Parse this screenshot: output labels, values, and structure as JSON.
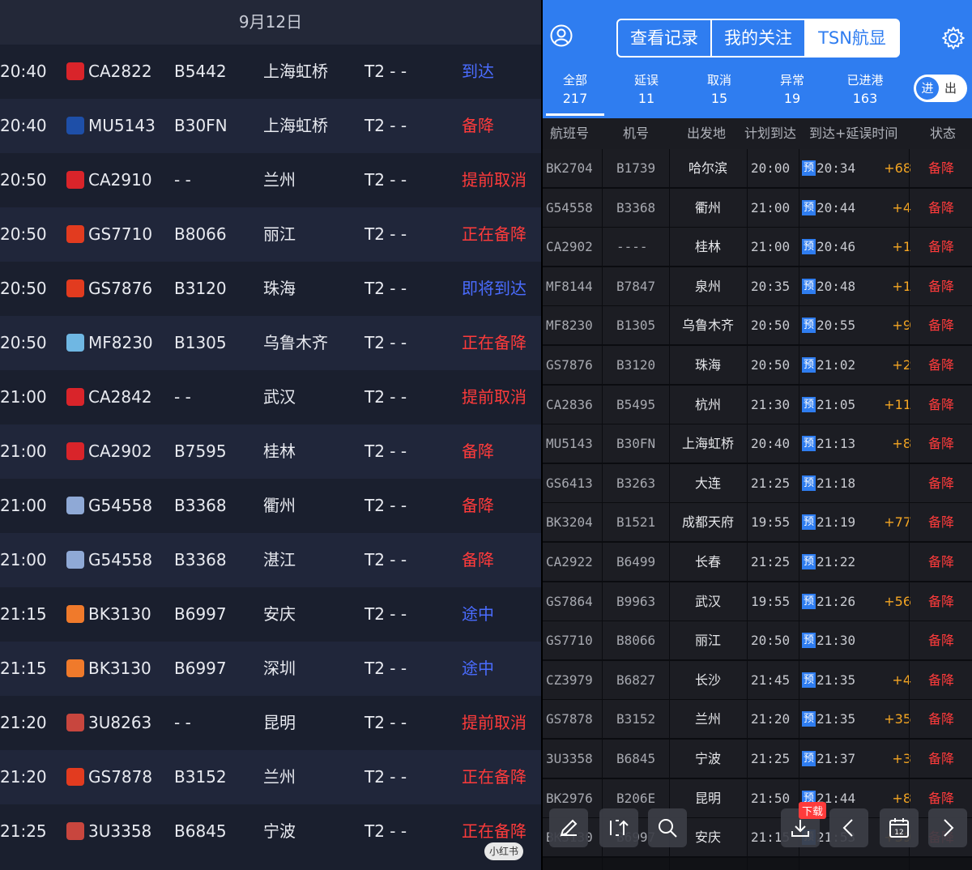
{
  "left_panel": {
    "date": "9月12日",
    "rows": [
      {
        "time": "20:40",
        "logo": "CA",
        "flight": "CA2822",
        "tail": "B5442",
        "city": "上海虹桥",
        "terminal": "T2 - -",
        "status": "到达",
        "status_color": "blue"
      },
      {
        "time": "20:40",
        "logo": "MU",
        "flight": "MU5143",
        "tail": "B30FN",
        "city": "上海虹桥",
        "terminal": "T2 - -",
        "status": "备降",
        "status_color": "red"
      },
      {
        "time": "20:50",
        "logo": "CA",
        "flight": "CA2910",
        "tail": "- -",
        "city": "兰州",
        "terminal": "T2 - -",
        "status": "提前取消",
        "status_color": "red"
      },
      {
        "time": "20:50",
        "logo": "GS",
        "flight": "GS7710",
        "tail": "B8066",
        "city": "丽江",
        "terminal": "T2 - -",
        "status": "正在备降",
        "status_color": "red"
      },
      {
        "time": "20:50",
        "logo": "GS",
        "flight": "GS7876",
        "tail": "B3120",
        "city": "珠海",
        "terminal": "T2 - -",
        "status": "即将到达",
        "status_color": "blue"
      },
      {
        "time": "20:50",
        "logo": "MF",
        "flight": "MF8230",
        "tail": "B1305",
        "city": "乌鲁木齐",
        "terminal": "T2 - -",
        "status": "正在备降",
        "status_color": "red"
      },
      {
        "time": "21:00",
        "logo": "CA",
        "flight": "CA2842",
        "tail": "- -",
        "city": "武汉",
        "terminal": "T2 - -",
        "status": "提前取消",
        "status_color": "red"
      },
      {
        "time": "21:00",
        "logo": "CA",
        "flight": "CA2902",
        "tail": "B7595",
        "city": "桂林",
        "terminal": "T2 - -",
        "status": "备降",
        "status_color": "red"
      },
      {
        "time": "21:00",
        "logo": "G5",
        "flight": "G54558",
        "tail": "B3368",
        "city": "衢州",
        "terminal": "T2 - -",
        "status": "备降",
        "status_color": "red"
      },
      {
        "time": "21:00",
        "logo": "G5",
        "flight": "G54558",
        "tail": "B3368",
        "city": "湛江",
        "terminal": "T2 - -",
        "status": "备降",
        "status_color": "red"
      },
      {
        "time": "21:15",
        "logo": "BK",
        "flight": "BK3130",
        "tail": "B6997",
        "city": "安庆",
        "terminal": "T2 - -",
        "status": "途中",
        "status_color": "blue"
      },
      {
        "time": "21:15",
        "logo": "BK",
        "flight": "BK3130",
        "tail": "B6997",
        "city": "深圳",
        "terminal": "T2 - -",
        "status": "途中",
        "status_color": "blue"
      },
      {
        "time": "21:20",
        "logo": "3U",
        "flight": "3U8263",
        "tail": "- -",
        "city": "昆明",
        "terminal": "T2 - -",
        "status": "提前取消",
        "status_color": "red"
      },
      {
        "time": "21:20",
        "logo": "GS",
        "flight": "GS7878",
        "tail": "B3152",
        "city": "兰州",
        "terminal": "T2 - -",
        "status": "正在备降",
        "status_color": "red"
      },
      {
        "time": "21:25",
        "logo": "3U",
        "flight": "3U3358",
        "tail": "B6845",
        "city": "宁波",
        "terminal": "T2 - -",
        "status": "正在备降",
        "status_color": "red"
      }
    ],
    "watermark": "小红书"
  },
  "right_panel": {
    "segments": [
      "查看记录",
      "我的关注",
      "TSN航显"
    ],
    "active_segment": "TSN航显",
    "stats": [
      {
        "label": "全部",
        "value": "217"
      },
      {
        "label": "延误",
        "value": "11"
      },
      {
        "label": "取消",
        "value": "15"
      },
      {
        "label": "异常",
        "value": "19"
      },
      {
        "label": "已进港",
        "value": "163"
      }
    ],
    "toggle": {
      "on": "进",
      "off": "出"
    },
    "headers": [
      "航班号",
      "机号",
      "出发地",
      "计划到达",
      "到达+延误时间",
      "状态"
    ],
    "pre_label": "预",
    "rows": [
      {
        "flight": "BK2704",
        "tail": "B1739",
        "city": "哈尔滨",
        "sched": "20:00",
        "est": "20:34",
        "delay": "+68",
        "status": "备降"
      },
      {
        "flight": "G54558",
        "tail": "B3368",
        "city": "衢州",
        "sched": "21:00",
        "est": "20:44",
        "delay": "+4",
        "status": "备降"
      },
      {
        "flight": "CA2902",
        "tail": "----",
        "city": "桂林",
        "sched": "21:00",
        "est": "20:46",
        "delay": "+1",
        "status": "备降"
      },
      {
        "flight": "MF8144",
        "tail": "B7847",
        "city": "泉州",
        "sched": "20:35",
        "est": "20:48",
        "delay": "+1",
        "status": "备降"
      },
      {
        "flight": "MF8230",
        "tail": "B1305",
        "city": "乌鲁木齐",
        "sched": "20:50",
        "est": "20:55",
        "delay": "+9",
        "status": "备降"
      },
      {
        "flight": "GS7876",
        "tail": "B3120",
        "city": "珠海",
        "sched": "20:50",
        "est": "21:02",
        "delay": "+2",
        "status": "备降"
      },
      {
        "flight": "CA2836",
        "tail": "B5495",
        "city": "杭州",
        "sched": "21:30",
        "est": "21:05",
        "delay": "+11",
        "status": "备降"
      },
      {
        "flight": "MU5143",
        "tail": "B30FN",
        "city": "上海虹桥",
        "sched": "20:40",
        "est": "21:13",
        "delay": "+8",
        "status": "备降"
      },
      {
        "flight": "GS6413",
        "tail": "B3263",
        "city": "大连",
        "sched": "21:25",
        "est": "21:18",
        "delay": "",
        "status": "备降"
      },
      {
        "flight": "BK3204",
        "tail": "B1521",
        "city": "成都天府",
        "sched": "19:55",
        "est": "21:19",
        "delay": "+77",
        "status": "备降"
      },
      {
        "flight": "CA2922",
        "tail": "B6499",
        "city": "长春",
        "sched": "21:25",
        "est": "21:22",
        "delay": "",
        "status": "备降"
      },
      {
        "flight": "GS7864",
        "tail": "B9963",
        "city": "武汉",
        "sched": "19:55",
        "est": "21:26",
        "delay": "+56",
        "status": "备降"
      },
      {
        "flight": "GS7710",
        "tail": "B8066",
        "city": "丽江",
        "sched": "20:50",
        "est": "21:30",
        "delay": "",
        "status": "备降"
      },
      {
        "flight": "CZ3979",
        "tail": "B6827",
        "city": "长沙",
        "sched": "21:45",
        "est": "21:35",
        "delay": "+4",
        "status": "备降"
      },
      {
        "flight": "GS7878",
        "tail": "B3152",
        "city": "兰州",
        "sched": "21:20",
        "est": "21:35",
        "delay": "+35",
        "status": "备降"
      },
      {
        "flight": "3U3358",
        "tail": "B6845",
        "city": "宁波",
        "sched": "21:25",
        "est": "21:37",
        "delay": "+3",
        "status": "备降"
      },
      {
        "flight": "BK2976",
        "tail": "B206E",
        "city": "昆明",
        "sched": "21:50",
        "est": "21:44",
        "delay": "+8",
        "status": "备降"
      },
      {
        "flight": "BK3130",
        "tail": "B6997",
        "city": "安庆",
        "sched": "21:15",
        "est": "21:53",
        "delay": "+39",
        "status": "备降"
      }
    ],
    "toolbar": {
      "download_badge": "下载",
      "calendar_day": "12",
      "icons": [
        "pencil-icon",
        "share-icon",
        "search-icon",
        "download-icon",
        "chevron-left-icon",
        "calendar-icon",
        "chevron-right-icon"
      ]
    }
  },
  "colors": {
    "left_bg": "#1a1f2e",
    "right_header": "#2f7df0",
    "status_red": "#ff3b3b",
    "status_blue": "#4a6cff",
    "delay_orange": "#f5a623"
  }
}
